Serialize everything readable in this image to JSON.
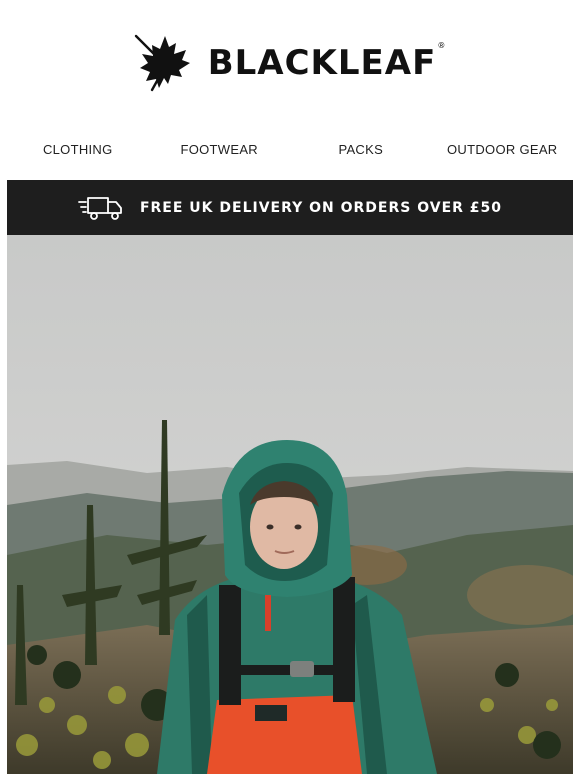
{
  "brand": {
    "name": "BLACKLEAF",
    "registered_mark": "®",
    "logo_icon": "maple-leaf-icon"
  },
  "nav": {
    "items": [
      {
        "label": "CLOTHING"
      },
      {
        "label": "FOOTWEAR"
      },
      {
        "label": "PACKS"
      },
      {
        "label": "OUTDOOR GEAR"
      }
    ]
  },
  "banner": {
    "icon": "delivery-truck-icon",
    "text": "FREE UK DELIVERY ON ORDERS OVER £50",
    "background": "#1e1e1e"
  },
  "hero": {
    "image": "hiker-in-green-rain-jacket-on-misty-hillside",
    "jacket_color": "#2e7a68",
    "accent_color": "#e8502a"
  }
}
